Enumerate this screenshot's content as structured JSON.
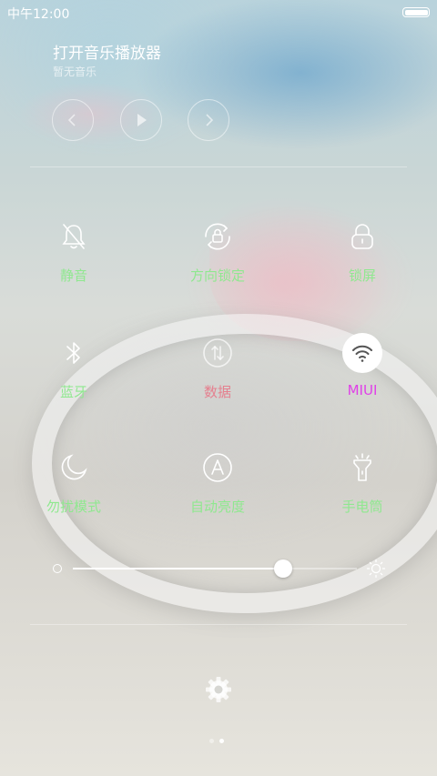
{
  "status_bar": {
    "time": "中午12:00"
  },
  "music": {
    "title": "打开音乐播放器",
    "subtitle": "暂无音乐",
    "controls": [
      "previous-icon",
      "play-icon",
      "next-icon"
    ]
  },
  "toggles": [
    {
      "label": "静音",
      "icon": "mute-bell-icon",
      "state": "on"
    },
    {
      "label": "方向锁定",
      "icon": "rotation-lock-icon",
      "state": "on"
    },
    {
      "label": "锁屏",
      "icon": "lock-icon",
      "state": "on"
    },
    {
      "label": "蓝牙",
      "icon": "bluetooth-icon",
      "state": "on"
    },
    {
      "label": "数据",
      "icon": "mobile-data-icon",
      "state": "off"
    },
    {
      "label": "MIUI",
      "icon": "wifi-icon",
      "state": "active"
    },
    {
      "label": "勿扰模式",
      "icon": "moon-icon",
      "state": "on"
    },
    {
      "label": "自动亮度",
      "icon": "auto-brightness-icon",
      "state": "on"
    },
    {
      "label": "手电筒",
      "icon": "flashlight-icon",
      "state": "on"
    }
  ],
  "brightness": {
    "value": 0.74
  },
  "colors": {
    "label_on": "#8fe88f",
    "label_off": "#e5808f",
    "label_active": "#e040e8"
  },
  "page_indicator": {
    "count": 2,
    "active": 1
  }
}
